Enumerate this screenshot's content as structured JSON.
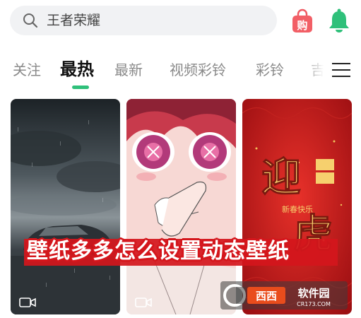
{
  "search": {
    "placeholder": "王者荣耀"
  },
  "header": {
    "shop_icon": "shopping-bag-icon",
    "shop_glyph": "购",
    "bell_icon": "bell-icon"
  },
  "tabs": [
    {
      "label": "关注",
      "active": false
    },
    {
      "label": "最热",
      "active": true
    },
    {
      "label": "最新",
      "active": false
    },
    {
      "label": "视频彩铃",
      "active": false
    },
    {
      "label": "彩铃",
      "active": false
    },
    {
      "label": "吉",
      "active": false
    }
  ],
  "colors": {
    "accent": "#2fc07a",
    "banner_red": "#d4161c"
  },
  "cards": [
    {
      "name": "stormy-car-wallpaper",
      "type": "video"
    },
    {
      "name": "anime-girl-wallpaper",
      "type": "video"
    },
    {
      "name": "tiger-new-year-wallpaper",
      "type": "video",
      "art_text": [
        "迎",
        "虎",
        "新春快乐"
      ]
    }
  ],
  "overlay": {
    "banner_text": "壁纸多多怎么设置动态壁纸"
  },
  "watermark": {
    "brand": "西西软件园",
    "domain": "CR173.COM"
  }
}
